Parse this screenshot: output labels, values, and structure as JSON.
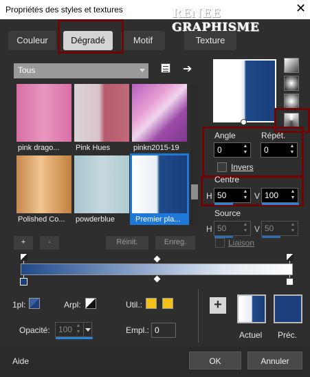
{
  "window": {
    "title": "Propriétés des styles et textures",
    "watermark": "RENEE GRAPHISME"
  },
  "tabs": [
    {
      "label": "Couleur"
    },
    {
      "label": "Dégradé"
    },
    {
      "label": "Motif"
    },
    {
      "label": "Texture"
    }
  ],
  "library": {
    "category": "Tous",
    "presets": [
      {
        "name": "pink drago..."
      },
      {
        "name": "Pink Hues"
      },
      {
        "name": "pinkn2015-19"
      },
      {
        "name": "Polished Co..."
      },
      {
        "name": "powderblue"
      },
      {
        "name": "Premier pla..."
      }
    ],
    "buttons": {
      "add": "+",
      "remove": "-",
      "reset": "Réinit.",
      "save": "Enreg."
    }
  },
  "params": {
    "angle_label": "Angle",
    "angle_value": "0",
    "repeat_label": "Répét.",
    "repeat_value": "0",
    "invert_label": "Invers",
    "center_label": "Centre",
    "center_h_label": "H",
    "center_h": "50",
    "center_v_label": "V",
    "center_v": "100",
    "source_label": "Source",
    "source_h_label": "H",
    "source_h": "50",
    "source_v_label": "V",
    "source_v": "50",
    "link_label": "Liaison"
  },
  "editor": {
    "ipl_label": "1pl:",
    "arpl_label": "Arpl:",
    "util_label": "Util.:",
    "opacity_label": "Opacité:",
    "opacity_value": "100",
    "empl_label": "Empl.:",
    "empl_value": "0"
  },
  "compare": {
    "current_label": "Actuel",
    "previous_label": "Préc."
  },
  "footer": {
    "help": "Aide",
    "ok": "OK",
    "cancel": "Annuler"
  },
  "colors": {
    "highlight_box": "#6e0606",
    "selection_blue": "#1e78d8",
    "navy": "#1a3f7c",
    "gold": "#f2c21b"
  }
}
